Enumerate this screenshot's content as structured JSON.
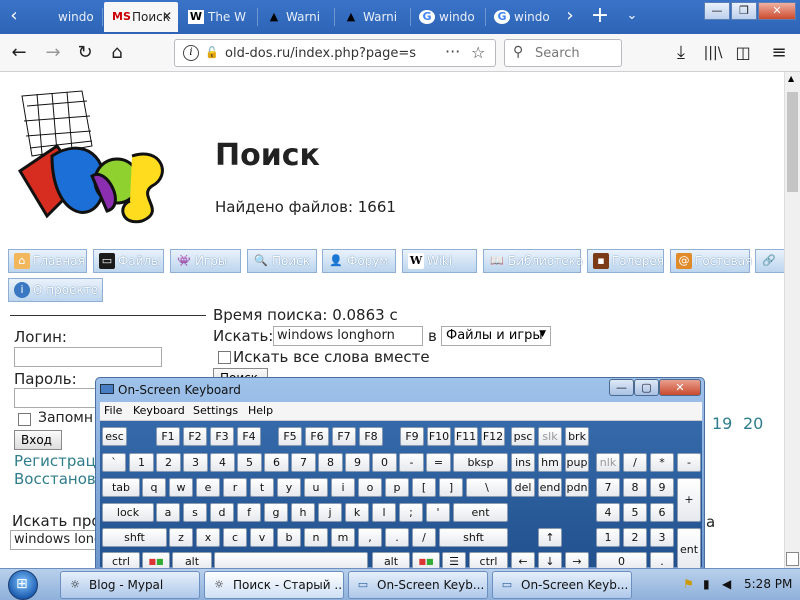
{
  "tabs": [
    {
      "label": "windo",
      "icon": "left-arrow"
    },
    {
      "label": "Поиск",
      "icon": "ms-dos-favicon"
    },
    {
      "label": "The W",
      "icon": "w-favicon"
    },
    {
      "label": "Warni",
      "icon": "warning-icon"
    },
    {
      "label": "Warni",
      "icon": "warning-icon"
    },
    {
      "label": "windo",
      "icon": "google-icon"
    },
    {
      "label": "windo",
      "icon": "google-icon"
    }
  ],
  "browser": {
    "url": "old-dos.ru/index.php?page=s",
    "search_placeholder": "Search"
  },
  "site": {
    "title": "Поиск",
    "found": "Найдено файлов: 1661",
    "nav": [
      {
        "label": "Главная"
      },
      {
        "label": "Файлы"
      },
      {
        "label": "Игры"
      },
      {
        "label": "Поиск"
      },
      {
        "label": "Форум"
      },
      {
        "label": "Wiki"
      },
      {
        "label": "Библиотека"
      },
      {
        "label": "Галерея"
      },
      {
        "label": "Гостевая"
      },
      {
        "label": ""
      },
      {
        "label": "О проекте"
      }
    ],
    "search_time": "Время поиска: 0.0863 с",
    "search_label": "Искать:",
    "search_value": "windows longhorn",
    "in_label": "в",
    "scope_value": "Файлы и игры",
    "all_words": "Искать все слова вместе",
    "search_button": "Поиск",
    "login_label": "Логин:",
    "password_label": "Пароль:",
    "remember": "Запомн",
    "login_button": "Вход",
    "register_link": "Регистраци",
    "restore_link": "Восстановл",
    "search_program": "Искать про",
    "search_program_value": "windows longh",
    "pages": [
      "19",
      "20"
    ],
    "partial_right": "а"
  },
  "osk": {
    "title": "On-Screen Keyboard",
    "menu": [
      "File",
      "Keyboard",
      "Settings",
      "Help"
    ],
    "controls": {
      "min": "—",
      "max": "▢",
      "close": "✕"
    },
    "rows": [
      [
        "esc",
        "F1",
        "F2",
        "F3",
        "F4",
        "F5",
        "F6",
        "F7",
        "F8",
        "F9",
        "F10",
        "F11",
        "F12",
        "psc",
        "slk",
        "brk"
      ],
      [
        "`",
        "1",
        "2",
        "3",
        "4",
        "5",
        "6",
        "7",
        "8",
        "9",
        "0",
        "-",
        "=",
        "bksp",
        "ins",
        "hm",
        "pup",
        "nlk",
        "/",
        "*",
        "-"
      ],
      [
        "tab",
        "q",
        "w",
        "e",
        "r",
        "t",
        "y",
        "u",
        "i",
        "o",
        "p",
        "[",
        "]",
        "\\",
        "del",
        "end",
        "pdn",
        "7",
        "8",
        "9",
        "+"
      ],
      [
        "lock",
        "a",
        "s",
        "d",
        "f",
        "g",
        "h",
        "j",
        "k",
        "l",
        ";",
        "'",
        "ent",
        "4",
        "5",
        "6"
      ],
      [
        "shft",
        "z",
        "x",
        "c",
        "v",
        "b",
        "n",
        "m",
        ",",
        ".",
        "/",
        "shft",
        "↑",
        "1",
        "2",
        "3",
        "ent"
      ],
      [
        "ctrl",
        "win",
        "alt",
        "",
        "alt",
        "win",
        "menu",
        "ctrl",
        "←",
        "↓",
        "→",
        "0",
        "."
      ]
    ]
  },
  "taskbar": {
    "items": [
      {
        "label": "Blog - Mypal"
      },
      {
        "label": "Поиск - Старый ..."
      },
      {
        "label": "On-Screen Keyb..."
      },
      {
        "label": "On-Screen Keyb..."
      }
    ],
    "clock": "5:28 PM"
  },
  "colors": {
    "link": "#2f7d8a",
    "osk_blue": "#2a5d9c",
    "taskbar": "#a6c2e6"
  }
}
